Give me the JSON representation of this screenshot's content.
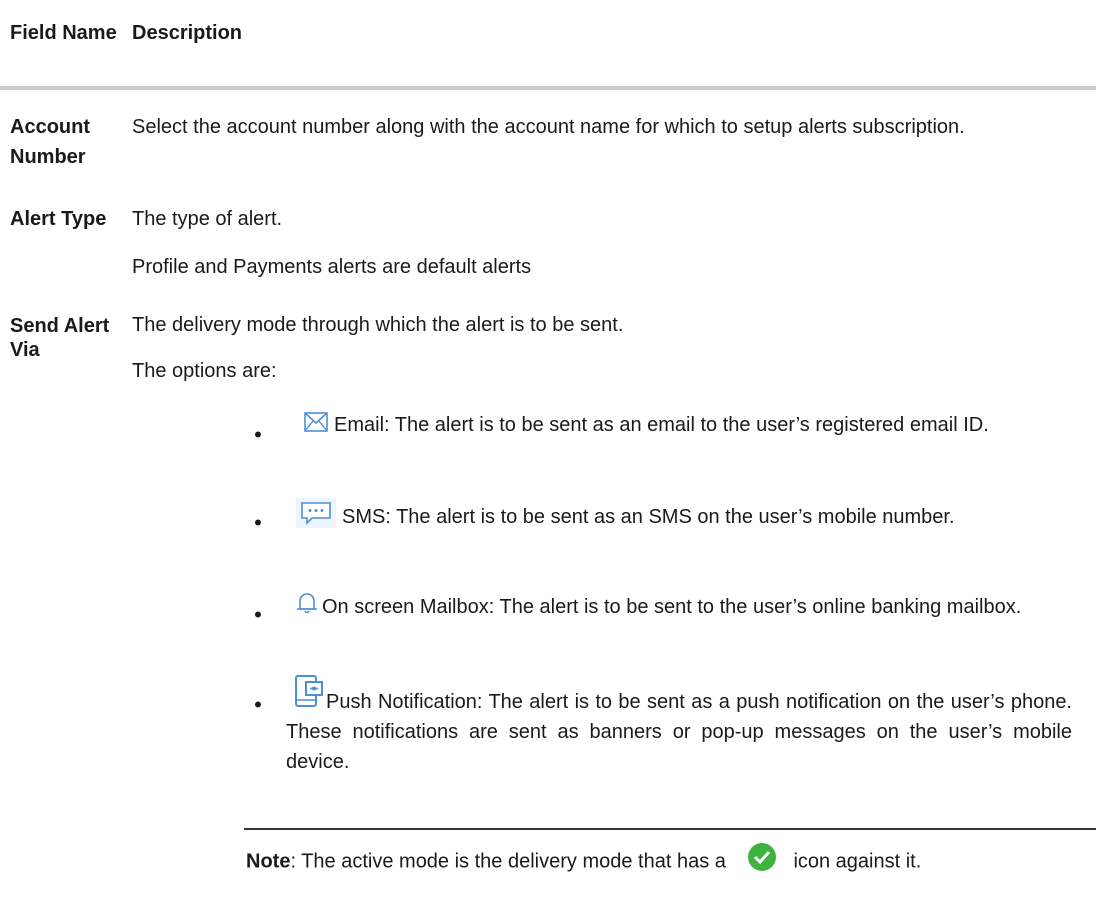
{
  "header": {
    "col1": "Field Name",
    "col2": "Description"
  },
  "rows": [
    {
      "label": "Account Number",
      "description": "Select the account number along with the account name for which to setup alerts subscription."
    },
    {
      "label": "Alert Type",
      "description": "The type of alert.",
      "description2": "Profile and Payments alerts are default alerts"
    },
    {
      "label": "Send Alert Via",
      "description": "The delivery mode through which the alert is to be sent.",
      "description2": "The options are:"
    }
  ],
  "options": [
    {
      "icon": "email-icon",
      "text": "Email: The alert is to be sent as an email to the user’s registered email ID."
    },
    {
      "icon": "sms-icon",
      "text": "SMS: The alert is to be sent as an SMS on the user’s mobile number."
    },
    {
      "icon": "bell-icon",
      "text": "On screen Mailbox: The alert is to be sent to the user’s online banking mailbox."
    },
    {
      "icon": "push-notification-icon",
      "text": "Push Notification: The alert is to be sent as a push notification on the user’s phone. These notifications are sent as banners or pop-up messages on the user’s mobile device."
    }
  ],
  "note": {
    "bold": "Note",
    "before_icon": ": The active mode is the delivery mode that has a",
    "after_icon": "icon against it."
  },
  "colors": {
    "icon_blue": "#4a90d9",
    "check_green": "#3fb33f",
    "rule_gray": "#c9c9c9"
  }
}
